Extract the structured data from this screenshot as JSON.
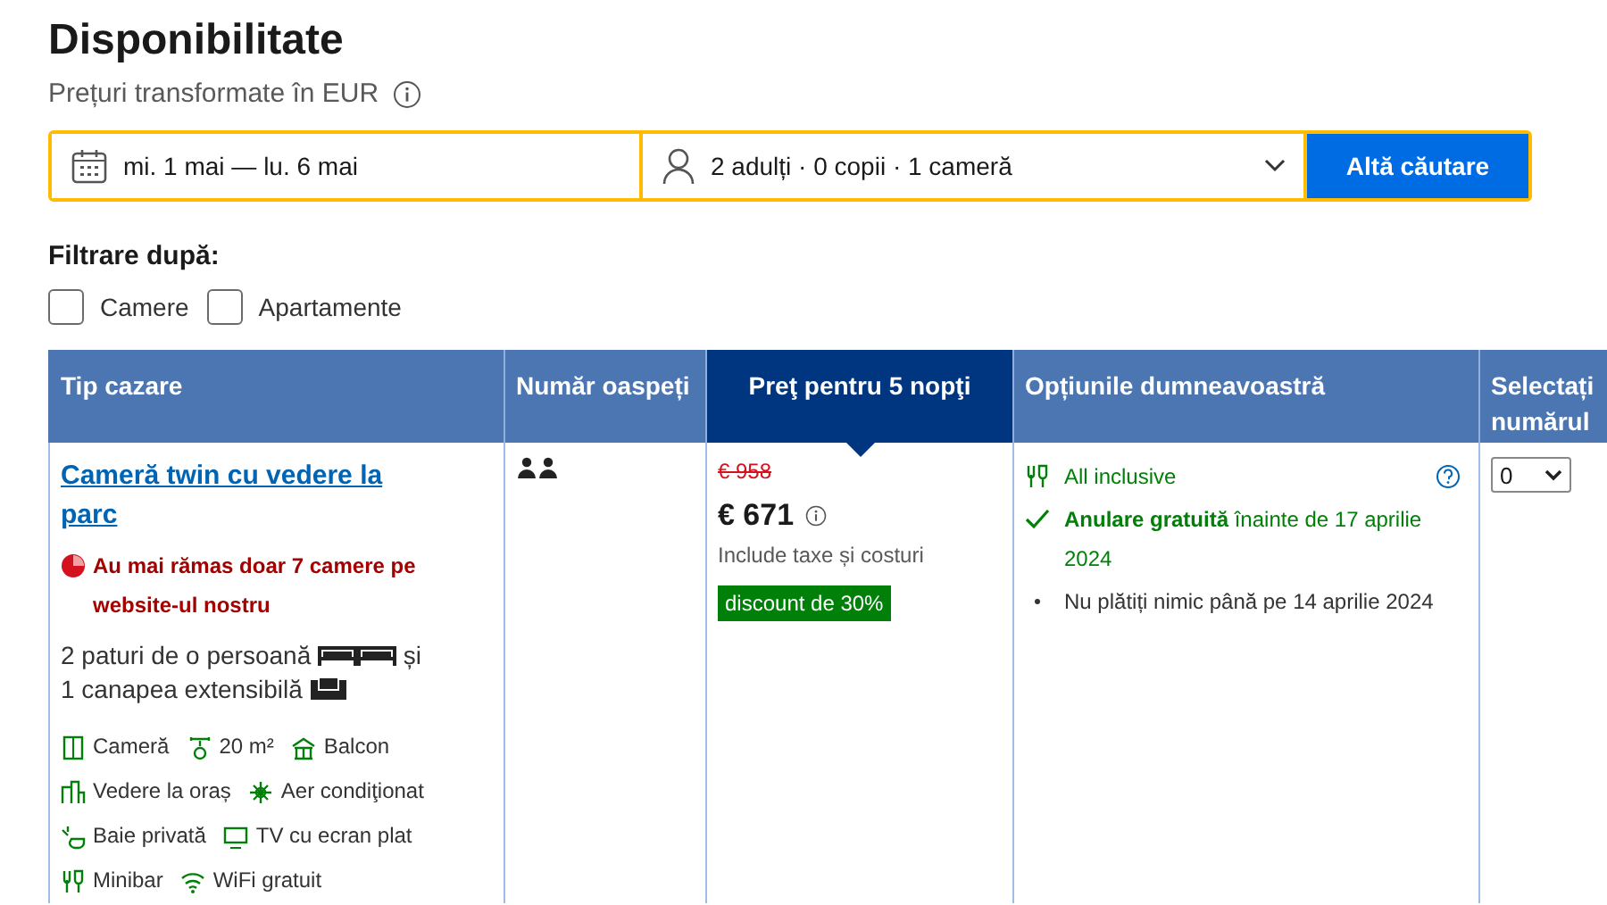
{
  "header": {
    "title": "Disponibilitate",
    "subtitle": "Prețuri transformate în EUR"
  },
  "search": {
    "dates": "mi. 1 mai — lu. 6 mai",
    "guests": "2 adulți · 0 copii · 1 cameră",
    "button": "Altă căutare"
  },
  "filters": {
    "title": "Filtrare după:",
    "options": [
      {
        "label": "Camere",
        "checked": false
      },
      {
        "label": "Apartamente",
        "checked": false
      }
    ]
  },
  "table": {
    "columns": [
      {
        "label": "Tip cazare",
        "selected": false
      },
      {
        "label": "Număr oaspeți",
        "selected": false
      },
      {
        "label": "Preţ pentru 5 nopţi",
        "selected": true
      },
      {
        "label": "Opțiunile dumneavoastră",
        "selected": false
      },
      {
        "label": "Selectați numărul",
        "selected": false
      }
    ],
    "row": {
      "room_name": "Cameră twin cu vedere la parc",
      "scarcity": "Au mai rămas doar 7 camere pe website-ul nostru",
      "beds": "2 paturi de o persoană",
      "beds_and": "și",
      "sofa": "1 canapea extensibilă",
      "facilities": [
        {
          "kind": "room",
          "label": "Cameră"
        },
        {
          "kind": "area",
          "label": "20 m²"
        },
        {
          "kind": "balcony",
          "label": "Balcon"
        },
        {
          "kind": "city",
          "label": "Vedere la oraș"
        },
        {
          "kind": "ac",
          "label": "Aer condiţionat"
        },
        {
          "kind": "bath",
          "label": "Baie privată"
        },
        {
          "kind": "tv",
          "label": "TV cu ecran plat"
        },
        {
          "kind": "minibar",
          "label": "Minibar"
        },
        {
          "kind": "wifi",
          "label": "WiFi gratuit"
        }
      ],
      "old_price": "€ 958",
      "price": "€ 671",
      "price_note": "Include taxe și costuri",
      "discount": "discount de 30%",
      "options": [
        {
          "kind": "meal",
          "text": "All inclusive"
        },
        {
          "kind": "check",
          "text": "**Anulare gratuită** înainte de 17 aprilie 2024"
        },
        {
          "kind": "bullet",
          "text": "Nu plătiți nimic până pe 14 aprilie 2024"
        }
      ],
      "quantity": "0"
    }
  }
}
